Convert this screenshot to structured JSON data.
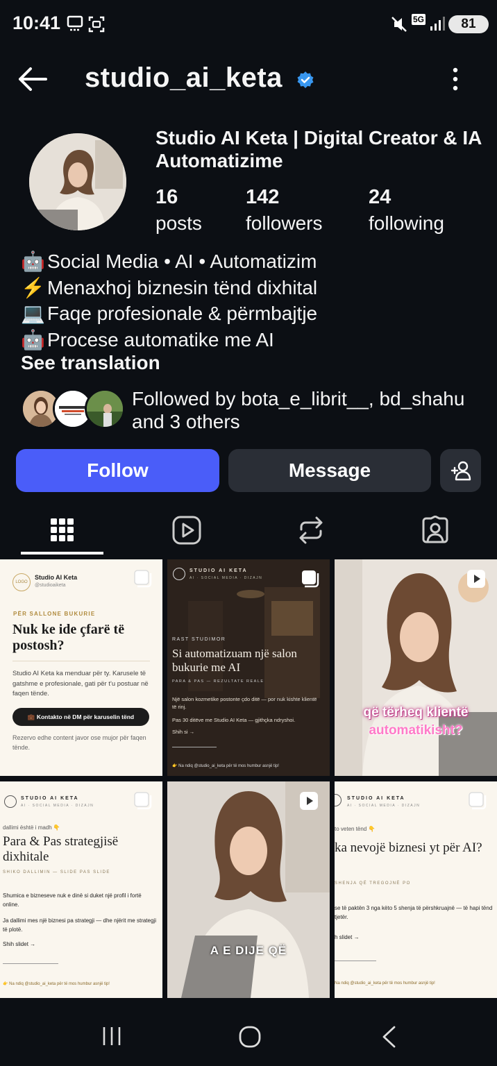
{
  "status_bar": {
    "time": "10:41",
    "network": "5G",
    "battery": "81"
  },
  "header": {
    "username": "studio_ai_keta"
  },
  "profile": {
    "display_name": "Studio AI Keta | Digital Creator & IA Automatizime",
    "stats": [
      {
        "value": "16",
        "label": "posts"
      },
      {
        "value": "142",
        "label": "followers"
      },
      {
        "value": "24",
        "label": "following"
      }
    ],
    "bio": [
      {
        "emoji": "🤖",
        "text": "Social Media • AI • Automatizim"
      },
      {
        "emoji": "⚡",
        "text": "Menaxhoj biznesin tënd dixhital"
      },
      {
        "emoji": "💻",
        "text": "Faqe profesionale & përmbajtje"
      },
      {
        "emoji": "🤖",
        "text": "Procese automatike me AI"
      }
    ],
    "see_translation": "See translation",
    "followed_by": "Followed by bota_e_librit__, bd_shahu and 3 others"
  },
  "actions": {
    "follow": "Follow",
    "message": "Message"
  },
  "posts": [
    {
      "brand": "Studio AI Keta",
      "handle": "@studioaiketa",
      "logo": "LOGO",
      "eyebrow": "PËR SALLONE BUKURIE",
      "title": "Nuk ke ide çfarë të postosh?",
      "body": "Studio AI Keta ka menduar për ty. Karusele të gatshme e profesionale, gati për t'u postuar në faqen tënde.",
      "cta": "💼 Kontakto në DM për karuselin tënd",
      "footer": "Rezervo edhe content javor ose mujor për faqen tënde."
    },
    {
      "brand": "STUDIO AI KETA",
      "sub": "AI · SOCIAL MEDIA · DIZAJN",
      "eyebrow": "RAST STUDIMOR",
      "title": "Si automatizuam një salon bukurie me AI",
      "kicker": "PARA & PAS — REZULTATE REALE",
      "body1": "Një salon kozmetike postonte çdo ditë — por nuk kishte klientë të rinj.",
      "body2": "Pas 30 ditëve me Studio AI Keta — gjithçka ndryshoi.",
      "link": "Shih si →",
      "footer": "👉 Na ndiq @studio_ai_keta për të mos humbur asnjë tip!"
    },
    {
      "caption1": "që tërheq klientë",
      "caption2": "automatikisht?"
    },
    {
      "brand": "STUDIO AI KETA",
      "sub": "AI · SOCIAL MEDIA · DIZAJN",
      "eyebrow": "dallimi është i madh 👇",
      "title": "Para & Pas strategjisë dixhitale",
      "kicker": "SHIKO DALLIMIN — SLIDE PAS SLIDE",
      "body1": "Shumica e bizneseve nuk e dinë si duket një profil i fortë online.",
      "body2": "Ja dallimi mes një biznesi pa strategji — dhe njërit me strategji të plotë.",
      "link": "Shih slidet →",
      "footer": "👉 Na ndiq @studio_ai_keta për të mos humbur asnjë tip!"
    },
    {
      "caption": "A E DIJE QË"
    },
    {
      "brand": "STUDIO AI KETA",
      "sub": "AI · SOCIAL MEDIA · DIZAJN",
      "eyebrow": "to veten tënd 👇",
      "title": "ka nevojë biznesi yt për AI?",
      "kicker": "SHENJA QË TREGOJNË PO",
      "body1": "se të paktën 3 nga këto 5 shenja të përshkruajnë — të hapi tënd tjetër.",
      "link": "h slidet →",
      "footer": "Na ndiq @studio_ai_keta për të mos humbur asnjë tip!"
    }
  ]
}
